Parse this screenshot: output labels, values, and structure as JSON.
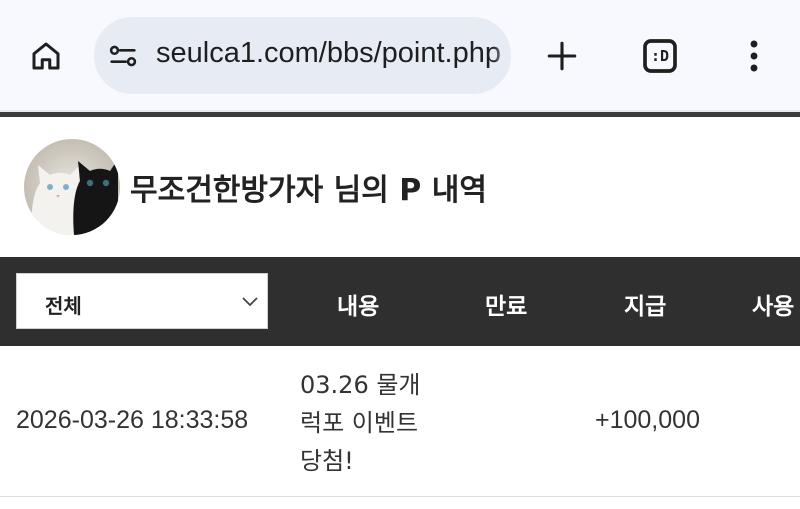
{
  "browser": {
    "url": "seulca1.com/bbs/point.php",
    "tab_count": ":D",
    "icons": {
      "home": "home-icon",
      "site_info": "site-info-icon",
      "new_tab": "plus-icon",
      "tabs": "tab-switcher-icon",
      "menu": "more-vert-icon"
    }
  },
  "profile": {
    "title": "무조건한방가자 님의 P 내역",
    "avatar": "two-cats-avatar"
  },
  "table": {
    "filter": {
      "selected": "전체"
    },
    "columns": [
      "내용",
      "만료",
      "지급",
      "사용"
    ],
    "rows": [
      {
        "date": "2026-03-26 18:33:58",
        "content": "03.26 물개 럭포 이벤트 당첨!",
        "expire": "",
        "give": "+100,000",
        "use": ""
      }
    ]
  },
  "colors": {
    "chrome_bg": "#f7f9fe",
    "url_bar_bg": "#e7ebf3",
    "header_bg": "#2f2f2f",
    "top_bar": "#3b3b3b"
  }
}
